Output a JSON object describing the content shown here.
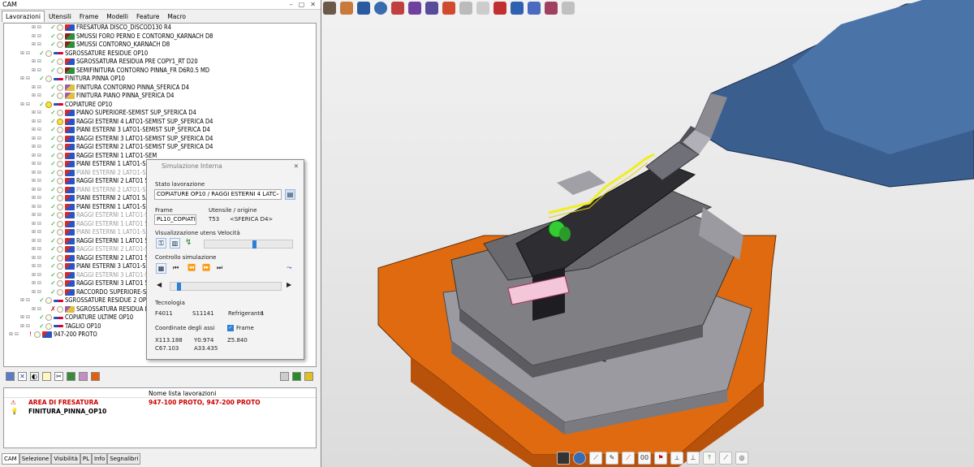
{
  "window_title": "CAM",
  "tabs": [
    "Lavorazioni",
    "Utensili",
    "Frame",
    "Modelli",
    "Feature",
    "Macro"
  ],
  "tree": [
    {
      "indent": 2,
      "check": "g",
      "bulb": false,
      "icon": "op",
      "label": "FRESATURA DISCO_DISCOD130 R4",
      "grey": false
    },
    {
      "indent": 2,
      "check": "g",
      "bulb": false,
      "icon": "sw",
      "label": "SMUSSI FORO PERNO E CONTORNO_KARNACH D8",
      "grey": false
    },
    {
      "indent": 2,
      "check": "g",
      "bulb": false,
      "icon": "sw",
      "label": "SMUSSI CONTORNO_KARNACH D8",
      "grey": false
    },
    {
      "indent": 1,
      "check": "g",
      "bulb": false,
      "icon": "grp",
      "label": "SGROSSATURE RESIDUE OP10",
      "grey": false
    },
    {
      "indent": 2,
      "check": "g",
      "bulb": false,
      "icon": "op",
      "label": "SGROSSATURA RESIDUA PRE COPY1_RT D20",
      "grey": false
    },
    {
      "indent": 2,
      "check": "g",
      "bulb": false,
      "icon": "sw",
      "label": "SEMIFINITURA CONTORNO PINNA_FR D6R0.5 MD",
      "grey": false
    },
    {
      "indent": 1,
      "check": "g",
      "bulb": false,
      "icon": "grp",
      "label": "FINITURA PINNA OP10",
      "grey": false
    },
    {
      "indent": 2,
      "check": "g",
      "bulb": false,
      "icon": "pk",
      "label": "FINITURA CONTORNO PINNA_SFERICA D4",
      "grey": false
    },
    {
      "indent": 2,
      "check": "g",
      "bulb": false,
      "icon": "pk",
      "label": "FINITURA PIANO PINNA_SFERICA D4",
      "grey": false
    },
    {
      "indent": 1,
      "check": "g",
      "bulb": true,
      "icon": "grp",
      "label": "COPIATURE OP10",
      "grey": false
    },
    {
      "indent": 2,
      "check": "g",
      "bulb": false,
      "icon": "op",
      "label": "PIANO SUPERIORE-SEMIST SUP_SFERICA D4",
      "grey": false
    },
    {
      "indent": 2,
      "check": "g",
      "bulb": true,
      "icon": "op",
      "label": "RAGGI ESTERNI 4 LATO1-SEMIST SUP_SFERICA D4",
      "grey": false
    },
    {
      "indent": 2,
      "check": "g",
      "bulb": false,
      "icon": "op",
      "label": "PIANI ESTERNI 3 LATO1-SEMIST SUP_SFERICA D4",
      "grey": false
    },
    {
      "indent": 2,
      "check": "g",
      "bulb": false,
      "icon": "op",
      "label": "RAGGI ESTERNI 3 LATO1-SEMIST SUP_SFERICA D4",
      "grey": false
    },
    {
      "indent": 2,
      "check": "g",
      "bulb": false,
      "icon": "op",
      "label": "RAGGI ESTERNI 2 LATO1-SEMIST SUP_SFERICA D4",
      "grey": false
    },
    {
      "indent": 2,
      "check": "g",
      "bulb": false,
      "icon": "op",
      "label": "RAGGI ESTERNI 1 LATO1-SEM",
      "grey": false
    },
    {
      "indent": 2,
      "check": "g",
      "bulb": false,
      "icon": "op",
      "label": "PIANI ESTERNI 1 LATO1-SEM",
      "grey": false
    },
    {
      "indent": 2,
      "check": "g",
      "bulb": false,
      "icon": "op",
      "label": "PIANI ESTERNI 2 LATO1-SEM",
      "grey": true
    },
    {
      "indent": 2,
      "check": "g",
      "bulb": false,
      "icon": "op",
      "label": "RAGGI ESTERNI 2 LATO1 5AX",
      "grey": false
    },
    {
      "indent": 2,
      "check": "g",
      "bulb": false,
      "icon": "op",
      "label": "PIANI ESTERNI 2 LATO1-SEM",
      "grey": true
    },
    {
      "indent": 2,
      "check": "g",
      "bulb": false,
      "icon": "op",
      "label": "PIANI ESTERNI 2 LATO1 5AX",
      "grey": false
    },
    {
      "indent": 2,
      "check": "g",
      "bulb": false,
      "icon": "op",
      "label": "PIANI ESTERNI 1 LATO1-SEM",
      "grey": false
    },
    {
      "indent": 2,
      "check": "g",
      "bulb": false,
      "icon": "op",
      "label": "RAGGI ESTERNI 1 LATO1-SE",
      "grey": true
    },
    {
      "indent": 2,
      "check": "g",
      "bulb": false,
      "icon": "op",
      "label": "RAGGI ESTERNI 1 LATO1 5AX",
      "grey": true
    },
    {
      "indent": 2,
      "check": "g",
      "bulb": false,
      "icon": "op",
      "label": "PIANI ESTERNI 1 LATO1-SE",
      "grey": true
    },
    {
      "indent": 2,
      "check": "g",
      "bulb": false,
      "icon": "op",
      "label": "RAGGI ESTERNI 1 LATO1 5AX",
      "grey": false
    },
    {
      "indent": 2,
      "check": "g",
      "bulb": false,
      "icon": "op",
      "label": "RAGGI ESTERNI 2 LATO1-SE",
      "grey": true
    },
    {
      "indent": 2,
      "check": "g",
      "bulb": false,
      "icon": "op",
      "label": "RAGGI ESTERNI 2 LATO1 5AX",
      "grey": false
    },
    {
      "indent": 2,
      "check": "g",
      "bulb": false,
      "icon": "op",
      "label": "PIANI ESTERNI 3 LATO1-SEM",
      "grey": false
    },
    {
      "indent": 2,
      "check": "g",
      "bulb": false,
      "icon": "op",
      "label": "RAGGI ESTERNI 3 LATO1-SE",
      "grey": true
    },
    {
      "indent": 2,
      "check": "g",
      "bulb": false,
      "icon": "op",
      "label": "RAGGI ESTERNI 3 LATO1 5AX",
      "grey": false
    },
    {
      "indent": 2,
      "check": "g",
      "bulb": false,
      "icon": "op",
      "label": "RACCORDO SUPERIORE-SEM",
      "grey": false
    },
    {
      "indent": 1,
      "check": "g",
      "bulb": false,
      "icon": "grp",
      "label": "SGROSSATURE RESIDUE 2 OP10",
      "grey": false
    },
    {
      "indent": 2,
      "check": "x",
      "bulb": false,
      "icon": "pk",
      "label": "SGROSSATURA RESIDUA DO",
      "grey": false
    },
    {
      "indent": 1,
      "check": "g",
      "bulb": false,
      "icon": "grp",
      "label": "COPIATURE ULTIME OP10",
      "grey": false
    },
    {
      "indent": 1,
      "check": "g",
      "bulb": false,
      "icon": "grp",
      "label": "TAGLIO OP10",
      "grey": false
    },
    {
      "indent": 0,
      "check": "",
      "bulb": false,
      "icon": "op",
      "label": "947-200 PROTO",
      "grey": false
    }
  ],
  "info": {
    "col1": "",
    "col2": "Nome lista lavorazioni",
    "rows": [
      {
        "name": "AREA DI FRESATURA",
        "value": "947-100 PROTO, 947-200 PROTO"
      },
      {
        "name": "FINITURA_PINNA_OP10",
        "value": ""
      }
    ]
  },
  "bottom_tabs": [
    "CAM",
    "Selezione",
    "Visibilità",
    "PL",
    "Info",
    "Segnalibri"
  ],
  "sim": {
    "title": "Simulazione Interna",
    "stato_label": "Stato lavorazione",
    "stato_value": "COPIATURE OP10 / RAGGI ESTERNI 4 LATC",
    "frame_label": "Frame",
    "frame_value": "PL10_COPIATI",
    "utensile_label": "Utensile / origine",
    "utensile_value": "T53",
    "utensile_name": "<SFERICA D4>",
    "visual_label": "Visualizzazione utens Velocità",
    "speed": 0.55,
    "controllo_label": "Controllo simulazione",
    "progress": 0.06,
    "tecnologia_label": "Tecnologia",
    "feed": "F4011",
    "spindle": "S11141",
    "refrigerante_label": "Refrigerante",
    "refrigerante_value": "1",
    "coord_label": "Coordinate degli assi",
    "frame_check_label": "Frame",
    "x": "X113.188",
    "y": "Y0.974",
    "z": "Z5.840",
    "c": "C67.103",
    "a": "A33.435"
  },
  "colors": {
    "accent": "#2c7fd6",
    "spindle": "#3a5f8f",
    "base": "#e06a10",
    "toolpath": "#f0ee20",
    "tool": "#33cc33"
  }
}
